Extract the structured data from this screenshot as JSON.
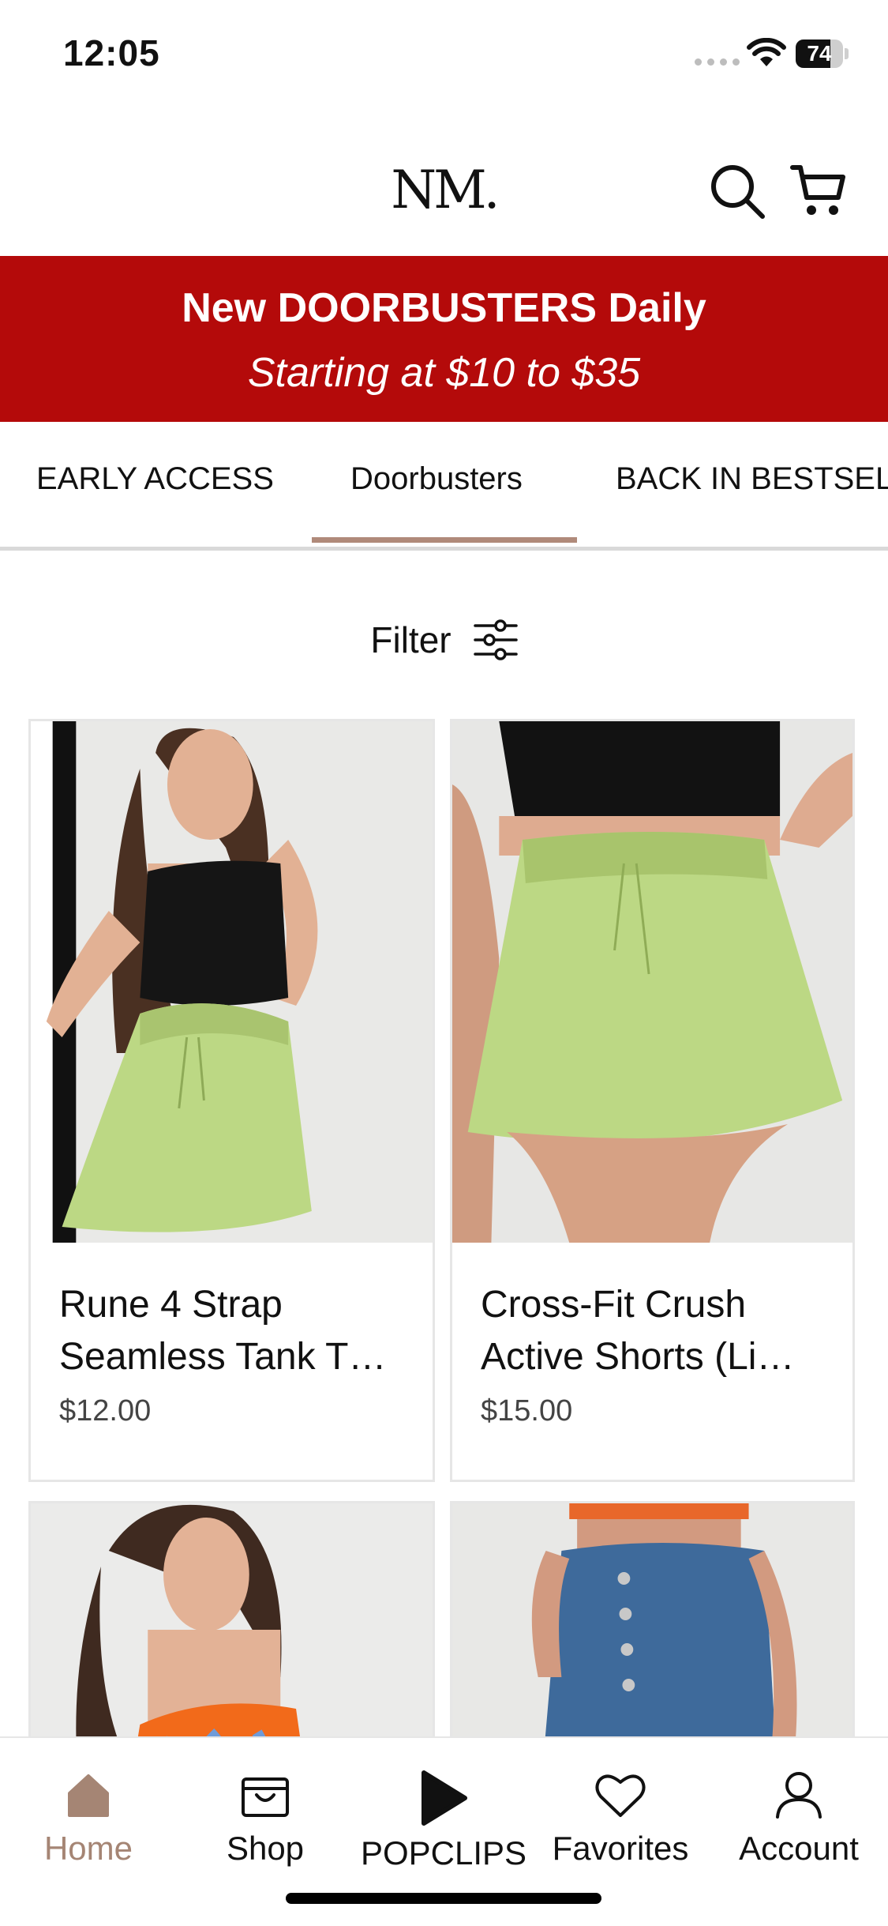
{
  "status_bar": {
    "time": "12:05",
    "battery": "74",
    "battery_level": 0.74
  },
  "header": {
    "logo": "NM.",
    "search_icon": "search-icon",
    "cart_icon": "cart-icon"
  },
  "promo": {
    "line1": "New DOORBUSTERS Daily",
    "line2": "Starting at $10 to $35",
    "background": "#b40a0a"
  },
  "tabs": [
    {
      "label": "EARLY ACCESS"
    },
    {
      "label": "Doorbusters",
      "selected": true
    },
    {
      "label": "BACK IN BESTSELLERS"
    }
  ],
  "filter": {
    "label": "Filter",
    "icon": "sliders-icon"
  },
  "products": [
    {
      "name": "Rune 4 Strap Seamless Tank T…",
      "price": "$12.00"
    },
    {
      "name": "Cross-Fit Crush Active Shorts (Li…",
      "price": "$15.00"
    },
    {
      "name": "",
      "price": ""
    },
    {
      "name": "",
      "price": ""
    }
  ],
  "tabbar": [
    {
      "label": "Home",
      "icon": "home-icon",
      "active": true
    },
    {
      "label": "Shop",
      "icon": "shopping-bag-icon"
    },
    {
      "label": "POPCLIPS",
      "icon": "play-icon"
    },
    {
      "label": "Favorites",
      "icon": "heart-icon"
    },
    {
      "label": "Account",
      "icon": "user-icon"
    }
  ],
  "colors": {
    "accent": "#b08a7a",
    "promo": "#b40a0a",
    "active_tab": "#a58574"
  }
}
